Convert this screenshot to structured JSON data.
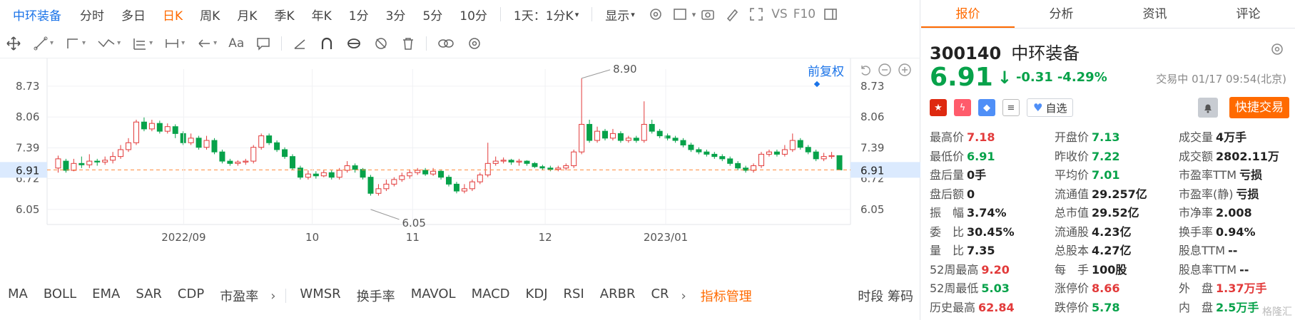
{
  "topbar": {
    "stock_name": "中环装备",
    "periods": [
      "分时",
      "多日",
      "日K",
      "周K",
      "月K",
      "季K",
      "年K",
      "1分",
      "3分",
      "5分",
      "10分"
    ],
    "active_period": "日K",
    "interval_select": "1天：1分K",
    "display_label": "显示",
    "vs_label": "VS",
    "f10_label": "F10"
  },
  "toolbar": {
    "icons": [
      "move-icon",
      "line-icon",
      "ray-icon",
      "wave-icon",
      "fib-icon",
      "range-icon",
      "arrow-icon",
      "text-icon",
      "comment-icon",
      "pen-icon",
      "magnet-icon",
      "lock-icon",
      "hide-icon",
      "delete-icon",
      "link-icon",
      "settings-icon"
    ],
    "text_tool": "Aa"
  },
  "chart": {
    "adjust_label": "前复权",
    "y_ticks": [
      "8.73",
      "8.06",
      "7.39",
      "6.72",
      "6.05"
    ],
    "current_price": "6.91",
    "high_marker": "8.90",
    "low_marker": "6.05",
    "x_labels": [
      "2022/09",
      "10",
      "11",
      "12",
      "2023/01"
    ],
    "up_color": "#e23a3a",
    "down_color": "#07a24a"
  },
  "chart_data": {
    "type": "candlestick",
    "title": "",
    "ylim": [
      5.8,
      9.1
    ],
    "current": 6.91,
    "annotations": {
      "max": 8.9,
      "min": 6.05
    },
    "x_ticks": [
      "2022/09",
      "10",
      "11",
      "12",
      "2023/01"
    ],
    "ohlc": [
      [
        6.95,
        7.15,
        7.22,
        6.85
      ],
      [
        7.1,
        6.9,
        7.15,
        6.85
      ],
      [
        6.9,
        7.05,
        7.15,
        6.88
      ],
      [
        7.05,
        7.02,
        7.2,
        6.95
      ],
      [
        7.02,
        7.1,
        7.25,
        6.95
      ],
      [
        7.1,
        7.08,
        7.15,
        7.0
      ],
      [
        7.08,
        7.12,
        7.2,
        7.02
      ],
      [
        7.12,
        7.2,
        7.3,
        7.05
      ],
      [
        7.2,
        7.35,
        7.45,
        7.15
      ],
      [
        7.35,
        7.5,
        7.6,
        7.3
      ],
      [
        7.5,
        7.95,
        8.0,
        7.45
      ],
      [
        7.95,
        7.8,
        8.05,
        7.75
      ],
      [
        7.8,
        7.92,
        8.0,
        7.75
      ],
      [
        7.92,
        7.75,
        7.98,
        7.7
      ],
      [
        7.75,
        7.85,
        7.92,
        7.7
      ],
      [
        7.85,
        7.7,
        7.9,
        7.6
      ],
      [
        7.7,
        7.5,
        7.75,
        7.45
      ],
      [
        7.5,
        7.6,
        7.7,
        7.45
      ],
      [
        7.6,
        7.4,
        7.65,
        7.35
      ],
      [
        7.4,
        7.55,
        7.65,
        7.35
      ],
      [
        7.55,
        7.3,
        7.6,
        7.25
      ],
      [
        7.3,
        7.1,
        7.35,
        7.05
      ],
      [
        7.1,
        7.05,
        7.15,
        7.0
      ],
      [
        7.05,
        7.08,
        7.12,
        7.0
      ],
      [
        7.08,
        7.1,
        7.15,
        7.02
      ],
      [
        7.1,
        7.4,
        7.45,
        7.05
      ],
      [
        7.4,
        7.65,
        7.7,
        7.35
      ],
      [
        7.65,
        7.5,
        7.7,
        7.45
      ],
      [
        7.5,
        7.35,
        7.55,
        7.3
      ],
      [
        7.35,
        7.2,
        7.4,
        7.15
      ],
      [
        7.2,
        6.95,
        7.25,
        6.9
      ],
      [
        6.95,
        6.75,
        7.0,
        6.7
      ],
      [
        6.75,
        6.82,
        6.9,
        6.7
      ],
      [
        6.82,
        6.78,
        6.88,
        6.72
      ],
      [
        6.78,
        6.85,
        6.9,
        6.75
      ],
      [
        6.85,
        6.75,
        6.9,
        6.7
      ],
      [
        6.75,
        6.9,
        6.95,
        6.7
      ],
      [
        6.9,
        7.0,
        7.1,
        6.85
      ],
      [
        7.0,
        6.92,
        7.05,
        6.85
      ],
      [
        6.92,
        6.75,
        6.95,
        6.7
      ],
      [
        6.75,
        6.4,
        6.8,
        6.35
      ],
      [
        6.4,
        6.5,
        6.6,
        6.35
      ],
      [
        6.5,
        6.6,
        6.7,
        6.45
      ],
      [
        6.6,
        6.7,
        6.75,
        6.55
      ],
      [
        6.7,
        6.78,
        6.85,
        6.65
      ],
      [
        6.78,
        6.85,
        6.92,
        6.72
      ],
      [
        6.85,
        6.9,
        6.95,
        6.8
      ],
      [
        6.9,
        6.82,
        6.95,
        6.78
      ],
      [
        6.82,
        6.88,
        6.95,
        6.78
      ],
      [
        6.88,
        6.75,
        6.92,
        6.7
      ],
      [
        6.75,
        6.6,
        6.8,
        6.55
      ],
      [
        6.6,
        6.45,
        6.65,
        6.4
      ],
      [
        6.45,
        6.5,
        6.6,
        6.4
      ],
      [
        6.5,
        6.65,
        6.7,
        6.45
      ],
      [
        6.65,
        6.8,
        6.85,
        6.6
      ],
      [
        6.8,
        7.05,
        7.5,
        6.75
      ],
      [
        7.05,
        7.1,
        7.2,
        7.0
      ],
      [
        7.1,
        7.12,
        7.18,
        7.05
      ],
      [
        7.12,
        7.08,
        7.15,
        7.02
      ],
      [
        7.08,
        7.1,
        7.15,
        7.0
      ],
      [
        7.1,
        7.05,
        7.12,
        7.0
      ],
      [
        7.05,
        6.98,
        7.08,
        6.95
      ],
      [
        6.98,
        6.95,
        7.02,
        6.9
      ],
      [
        6.95,
        6.92,
        7.0,
        6.88
      ],
      [
        6.92,
        6.95,
        7.0,
        6.88
      ],
      [
        6.95,
        7.0,
        7.05,
        6.9
      ],
      [
        7.0,
        7.3,
        7.35,
        6.95
      ],
      [
        7.3,
        7.9,
        8.9,
        7.25
      ],
      [
        7.9,
        7.55,
        8.0,
        7.5
      ],
      [
        7.55,
        7.75,
        7.85,
        7.5
      ],
      [
        7.75,
        7.6,
        7.8,
        7.55
      ],
      [
        7.6,
        7.7,
        7.8,
        7.55
      ],
      [
        7.7,
        7.55,
        7.75,
        7.5
      ],
      [
        7.55,
        7.6,
        7.65,
        7.5
      ],
      [
        7.6,
        7.55,
        7.65,
        7.5
      ],
      [
        7.55,
        7.9,
        8.4,
        7.5
      ],
      [
        7.9,
        7.75,
        8.0,
        7.7
      ],
      [
        7.75,
        7.65,
        7.8,
        7.6
      ],
      [
        7.65,
        7.6,
        7.7,
        7.55
      ],
      [
        7.6,
        7.55,
        7.65,
        7.5
      ],
      [
        7.55,
        7.45,
        7.6,
        7.4
      ],
      [
        7.45,
        7.35,
        7.5,
        7.3
      ],
      [
        7.35,
        7.3,
        7.4,
        7.25
      ],
      [
        7.3,
        7.25,
        7.35,
        7.2
      ],
      [
        7.25,
        7.2,
        7.3,
        7.15
      ],
      [
        7.2,
        7.15,
        7.25,
        7.1
      ],
      [
        7.15,
        7.05,
        7.2,
        7.0
      ],
      [
        7.05,
        6.95,
        7.1,
        6.9
      ],
      [
        6.95,
        6.9,
        7.0,
        6.85
      ],
      [
        6.9,
        7.0,
        7.05,
        6.85
      ],
      [
        7.0,
        7.25,
        7.3,
        6.95
      ],
      [
        7.25,
        7.3,
        7.35,
        7.2
      ],
      [
        7.3,
        7.25,
        7.35,
        7.2
      ],
      [
        7.25,
        7.35,
        7.45,
        7.2
      ],
      [
        7.35,
        7.55,
        7.7,
        7.3
      ],
      [
        7.55,
        7.4,
        7.6,
        7.35
      ],
      [
        7.4,
        7.3,
        7.45,
        7.25
      ],
      [
        7.3,
        7.15,
        7.35,
        7.1
      ],
      [
        7.15,
        7.2,
        7.28,
        7.1
      ],
      [
        7.2,
        7.22,
        7.3,
        7.15
      ],
      [
        7.22,
        6.91,
        7.18,
        6.91
      ]
    ]
  },
  "indicators": {
    "items": [
      "MA",
      "BOLL",
      "EMA",
      "SAR",
      "CDP",
      "市盈率"
    ],
    "items2": [
      "WMSR",
      "换手率",
      "MAVOL",
      "MACD",
      "KDJ",
      "RSI",
      "ARBR",
      "CR"
    ],
    "manage_label": "指标管理",
    "right_label": "时段 筹码"
  },
  "panel": {
    "tabs": [
      "报价",
      "分析",
      "资讯",
      "评论"
    ],
    "active_tab": "报价",
    "code": "300140",
    "name": "中环装备",
    "price": "6.91",
    "change": "-0.31",
    "change_pct": "-4.29%",
    "status": "交易中 01/17 09:54(北京)",
    "add_fav": "自选",
    "quick_trade": "快捷交易",
    "rows": [
      [
        {
          "l": "最高价",
          "v": "7.18",
          "c": "r"
        },
        {
          "l": "开盘价",
          "v": "7.13",
          "c": "g"
        },
        {
          "l": "成交量",
          "v": "4万手",
          "c": ""
        }
      ],
      [
        {
          "l": "最低价",
          "v": "6.91",
          "c": "g"
        },
        {
          "l": "昨收价",
          "v": "7.22",
          "c": "g"
        },
        {
          "l": "成交额",
          "v": "2802.11万",
          "c": ""
        }
      ],
      [
        {
          "l": "盘后量",
          "v": "0手",
          "c": ""
        },
        {
          "l": "平均价",
          "v": "7.01",
          "c": "g"
        },
        {
          "l": "市盈率TTM",
          "v": "亏损",
          "c": ""
        }
      ],
      [
        {
          "l": "盘后额",
          "v": "0",
          "c": ""
        },
        {
          "l": "流通值",
          "v": "29.257亿",
          "c": ""
        },
        {
          "l": "市盈率(静)",
          "v": "亏损",
          "c": ""
        }
      ],
      [
        {
          "l": "振　幅",
          "v": "3.74%",
          "c": ""
        },
        {
          "l": "总市值",
          "v": "29.52亿",
          "c": ""
        },
        {
          "l": "市净率",
          "v": "2.008",
          "c": ""
        }
      ],
      [
        {
          "l": "委　比",
          "v": "30.45%",
          "c": ""
        },
        {
          "l": "流通股",
          "v": "4.23亿",
          "c": ""
        },
        {
          "l": "换手率",
          "v": "0.94%",
          "c": ""
        }
      ],
      [
        {
          "l": "量　比",
          "v": "7.35",
          "c": ""
        },
        {
          "l": "总股本",
          "v": "4.27亿",
          "c": ""
        },
        {
          "l": "股息TTM",
          "v": "--",
          "c": ""
        }
      ],
      [
        {
          "l": "52周最高",
          "v": "9.20",
          "c": "r"
        },
        {
          "l": "每　手",
          "v": "100股",
          "c": ""
        },
        {
          "l": "股息率TTM",
          "v": "--",
          "c": ""
        }
      ],
      [
        {
          "l": "52周最低",
          "v": "5.03",
          "c": "g"
        },
        {
          "l": "涨停价",
          "v": "8.66",
          "c": "r"
        },
        {
          "l": "外　盘",
          "v": "1.37万手",
          "c": "r"
        }
      ],
      [
        {
          "l": "历史最高",
          "v": "62.84",
          "c": "r"
        },
        {
          "l": "跌停价",
          "v": "5.78",
          "c": "g"
        },
        {
          "l": "内　盘",
          "v": "2.5万手",
          "c": "g"
        }
      ]
    ],
    "watermark": "格隆汇"
  }
}
